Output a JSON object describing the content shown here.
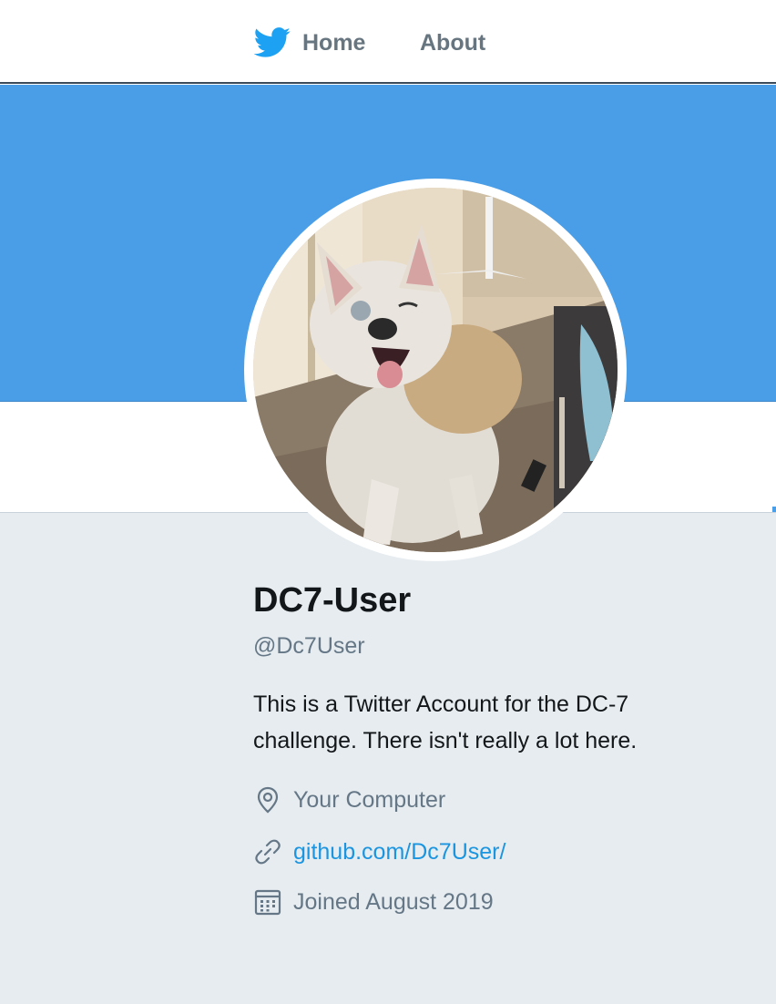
{
  "nav": {
    "home_label": "Home",
    "about_label": "About"
  },
  "colors": {
    "banner": "#4a9ee7",
    "accent": "#1b95e0",
    "bird": "#1da1f2",
    "background": "#e6ecf0"
  },
  "profile": {
    "name": "DC7-User",
    "handle": "@Dc7User",
    "bio": "This is a Twitter Account for the DC-7 challenge. There isn't really a lot here.",
    "location": "Your Computer",
    "url": "github.com/Dc7User/",
    "joined": "Joined August 2019"
  },
  "icons": {
    "logo": "twitter-bird-icon",
    "location": "location-pin-icon",
    "url": "link-icon",
    "joined": "calendar-icon"
  }
}
